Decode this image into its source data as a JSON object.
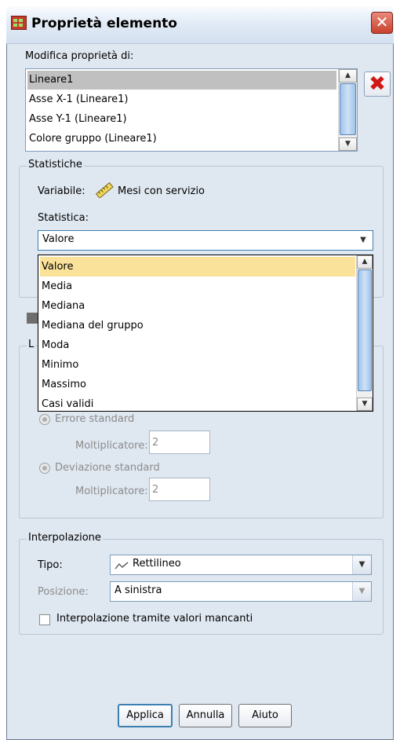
{
  "window": {
    "title": "Proprietà elemento",
    "close_glyph": "✕"
  },
  "edit_props": {
    "label": "Modifica proprietà di:",
    "items": [
      {
        "label": "Lineare1",
        "selected": true
      },
      {
        "label": "Asse X-1 (Lineare1)",
        "selected": false
      },
      {
        "label": "Asse Y-1 (Lineare1)",
        "selected": false
      },
      {
        "label": "Colore gruppo (Lineare1)",
        "selected": false
      }
    ],
    "delete_glyph": "✖"
  },
  "statistics": {
    "legend": "Statistiche",
    "variable_label": "Variabile:",
    "variable_icon": "ruler-icon",
    "variable_value": "Mesi con servizio",
    "stat_label": "Statistica:",
    "stat_selected": "Valore",
    "options": [
      "Valore",
      "Media",
      "Mediana",
      "Mediana del gruppo",
      "Moda",
      "Minimo",
      "Massimo",
      "Casi validi"
    ],
    "highlighted_index": 0
  },
  "intervals": {
    "legend_fragment": "L",
    "std_error_label": "Errore standard",
    "multiplier_label": "Moltiplicatore:",
    "std_error_multiplier": "2",
    "std_dev_label": "Deviazione standard",
    "std_dev_multiplier": "2"
  },
  "interpolation": {
    "legend": "Interpolazione",
    "type_label": "Tipo:",
    "type_icon": "straight-line-icon",
    "type_value": "Rettilineo",
    "position_label": "Posizione:",
    "position_value": "A sinistra",
    "missing_label": "Interpolazione tramite valori mancanti",
    "missing_checked": false
  },
  "footer": {
    "apply": "Applica",
    "cancel": "Annulla",
    "help": "Aiuto"
  },
  "colors": {
    "frame_bg": "#dfe7f0",
    "highlight": "#fbe29b",
    "delete_red": "#d01818",
    "title_icon_red": "#c23b2a"
  }
}
